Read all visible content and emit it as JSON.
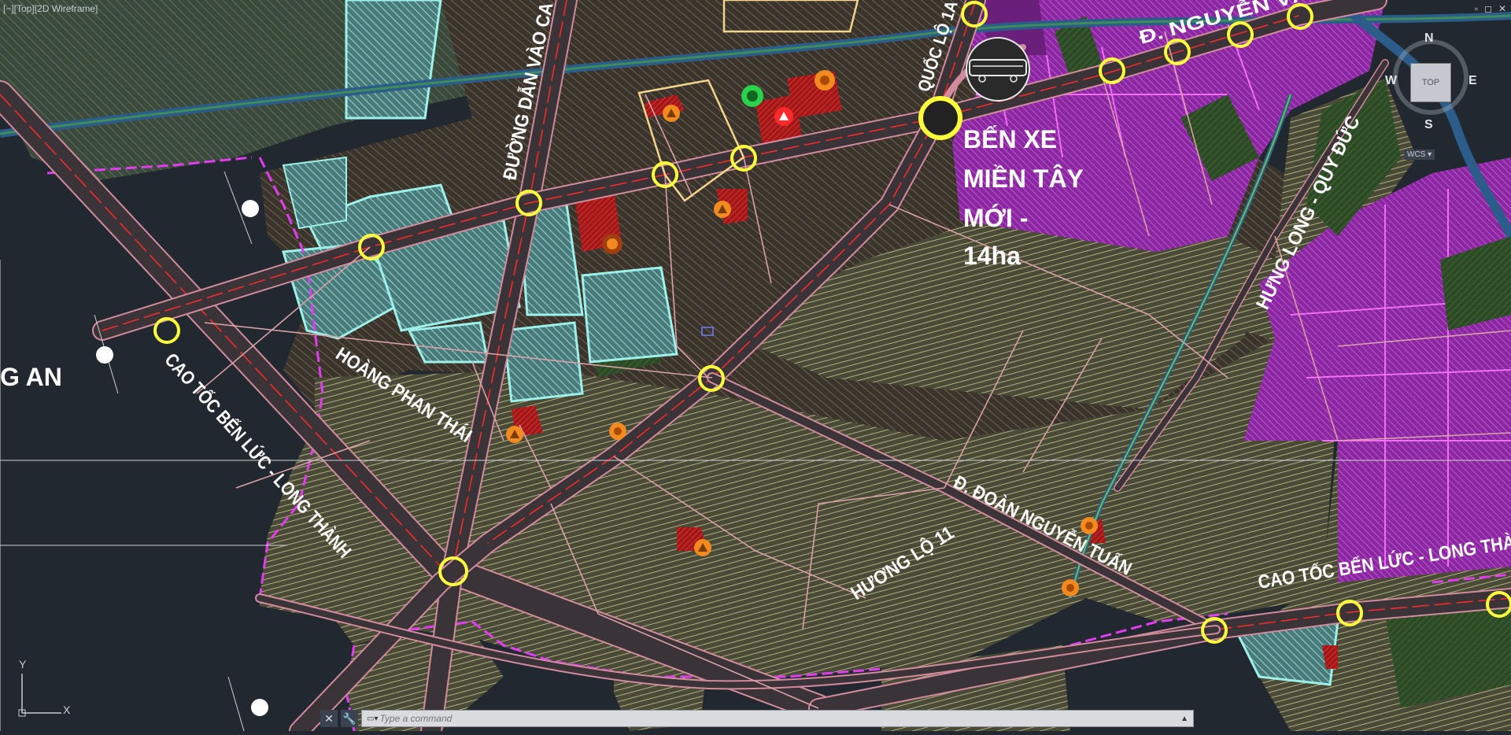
{
  "viewport": {
    "label": "[−][Top][2D Wireframe]",
    "window_controls": [
      "▫",
      "◻",
      "✕"
    ]
  },
  "map": {
    "roads": {
      "duong_dan": "ĐƯỜNG DẪN VÀO CA",
      "quoc_lo": "QUỐC LỘ 1A",
      "nguyen_van_linh": "Đ. NGUYỄN VĂN LI",
      "hung_long": "HƯNG LONG - QUY ĐỨC",
      "hoang_phan_thai": "HOÀNG PHAN THÁI",
      "cao_toc_left": "CAO TỐC BẾN LỨC - LONG THÀNH",
      "cao_toc_right": "CAO TỐC BẾN LỨC - LONG THÀ",
      "doan_nguyen_tuan": "Đ. ĐOÀN NGUYỄN TUẤN",
      "huong_lo": "HƯƠNG LỘ 11"
    },
    "station": {
      "line1": "BẾN XE",
      "line2": "MIỀN TÂY",
      "line3": "MỚI -",
      "line4": "14ha"
    },
    "edge_label": "G AN",
    "colors": {
      "background": "#212830",
      "road_fill": "#3a3438",
      "road_edge": "#d28b9c",
      "center_line": "#ff2a2a",
      "node": "#ffff3c",
      "zone_khaki": "#8d8a5e",
      "zone_dark": "#4a4335",
      "zone_cyan": "#7fe5e0",
      "zone_magenta": "#b434c8",
      "zone_green": "#2b4a25",
      "boundary": "#e23cf0",
      "water": "#2c6aa8"
    }
  },
  "viewcube": {
    "north": "N",
    "east": "E",
    "south": "S",
    "west": "W",
    "top": "TOP",
    "wcs": "WCS ▾"
  },
  "ucs": {
    "x": "X",
    "y": "Y"
  },
  "command": {
    "placeholder": "Type a command",
    "close_icon": "✕",
    "customize_icon": "🔧",
    "prompt_icon": "▭▾"
  }
}
